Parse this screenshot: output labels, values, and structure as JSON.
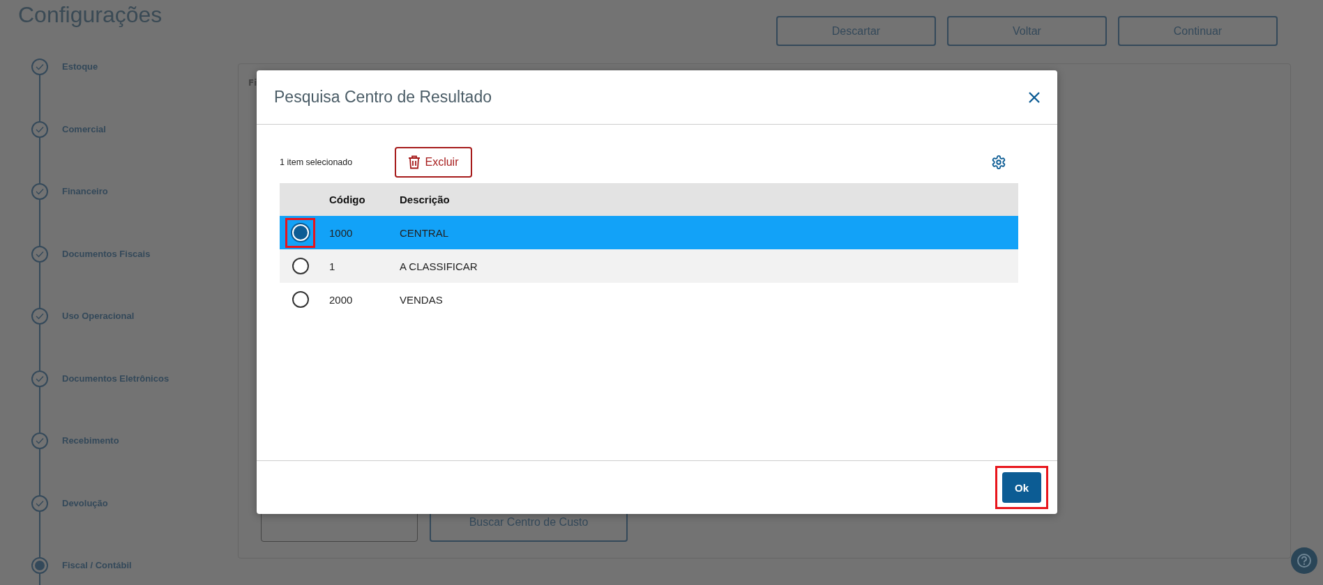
{
  "page": {
    "title": "Configurações",
    "actions": [
      "Descartar",
      "Voltar",
      "Continuar"
    ]
  },
  "steps": [
    {
      "label": "Estoque",
      "done": true,
      "current": false
    },
    {
      "label": "Comercial",
      "done": true,
      "current": false
    },
    {
      "label": "Financeiro",
      "done": true,
      "current": false
    },
    {
      "label": "Documentos Fiscais",
      "done": true,
      "current": false
    },
    {
      "label": "Uso Operacional",
      "done": true,
      "current": false
    },
    {
      "label": "Documentos Eletrônicos",
      "done": true,
      "current": false
    },
    {
      "label": "Recebimento",
      "done": true,
      "current": false
    },
    {
      "label": "Devolução",
      "done": true,
      "current": false
    },
    {
      "label": "Fiscal / Contábil",
      "done": false,
      "current": true
    }
  ],
  "panel": {
    "label_fragment": "Fi",
    "search_button": "Buscar Centro de Custo"
  },
  "modal": {
    "title": "Pesquisa Centro de Resultado",
    "selection_count": "1 item selecionado",
    "delete_button": "Excluir",
    "columns": [
      "Código",
      "Descrição"
    ],
    "rows": [
      {
        "code": "1000",
        "description": "CENTRAL",
        "selected": true,
        "highlighted": true
      },
      {
        "code": "1",
        "description": "A CLASSIFICAR",
        "selected": false,
        "highlighted": false
      },
      {
        "code": "2000",
        "description": "VENDAS",
        "selected": false,
        "highlighted": false
      }
    ],
    "confirm_button": "Ok",
    "confirm_highlighted": true
  }
}
